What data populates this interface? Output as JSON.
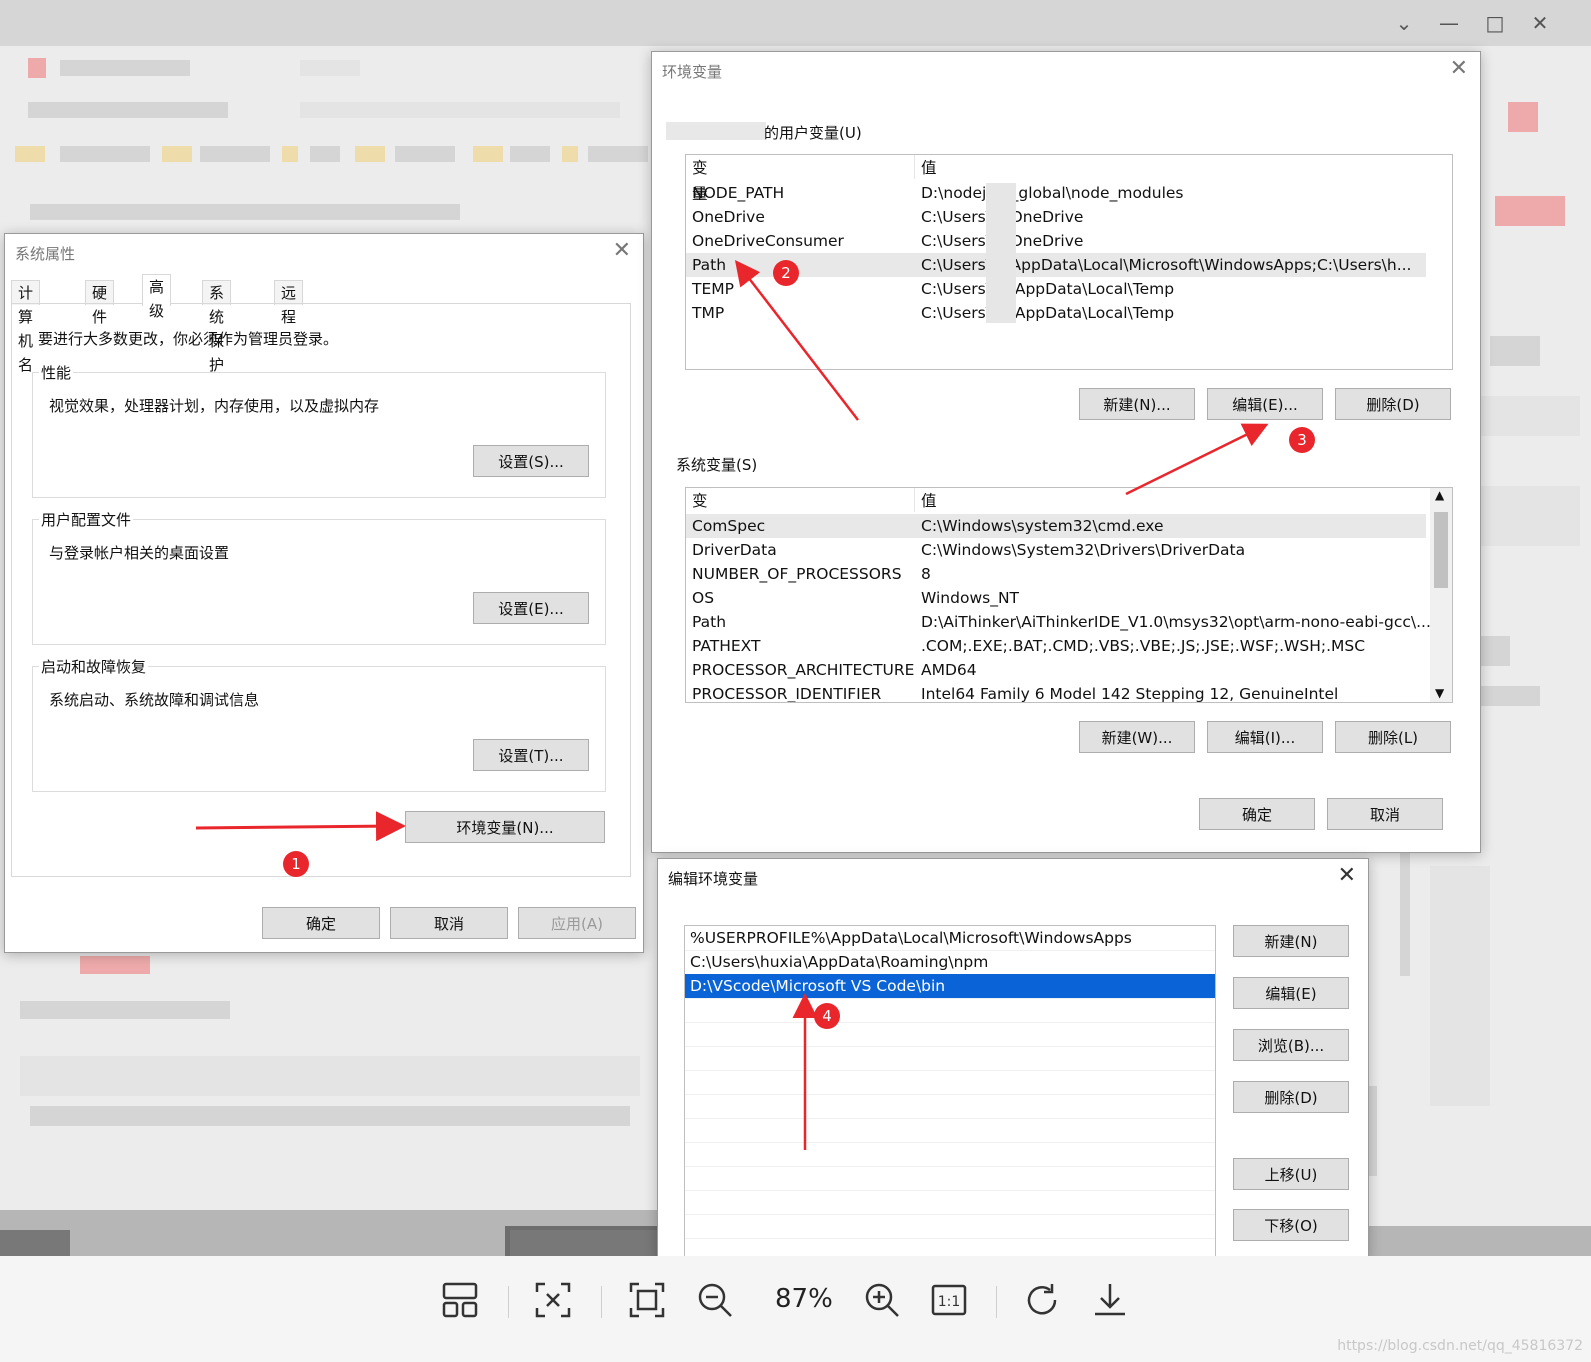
{
  "viewer": {
    "zoom": "87%",
    "watermark": "https://blog.csdn.net/qq_45816372",
    "tools": [
      "gallery-icon",
      "fit-screen-icon",
      "full-size-icon",
      "zoom-out-icon",
      "zoom-in-icon",
      "actual-size-icon",
      "rotate-icon",
      "download-icon"
    ]
  },
  "system_properties": {
    "title": "系统属性",
    "tabs": [
      "计算机名",
      "硬件",
      "高级",
      "系统保护",
      "远程"
    ],
    "active_tab": "高级",
    "admin_note": "要进行大多数更改，你必须作为管理员登录。",
    "performance": {
      "label": "性能",
      "desc": "视觉效果，处理器计划，内存使用，以及虚拟内存",
      "button": "设置(S)..."
    },
    "user_profiles": {
      "label": "用户配置文件",
      "desc": "与登录帐户相关的桌面设置",
      "button": "设置(E)..."
    },
    "startup_recovery": {
      "label": "启动和故障恢复",
      "desc": "系统启动、系统故障和调试信息",
      "button": "设置(T)..."
    },
    "env_button": "环境变量(N)...",
    "ok": "确定",
    "cancel": "取消",
    "apply": "应用(A)"
  },
  "env_vars": {
    "title": "环境变量",
    "user_section": "的用户变量(U)",
    "col_var": "变量",
    "col_val": "值",
    "user_rows": [
      {
        "name": "NODE_PATH",
        "value": "D:\\nodej      de_global\\node_modules"
      },
      {
        "name": "OneDrive",
        "value": "C:\\Users\\      a\\OneDrive"
      },
      {
        "name": "OneDriveConsumer",
        "value": "C:\\Users\\      a\\OneDrive"
      },
      {
        "name": "Path",
        "value": "C:\\Users\\      a\\AppData\\Local\\Microsoft\\WindowsApps;C:\\Users\\h..."
      },
      {
        "name": "TEMP",
        "value": "C:\\Users\\      ia\\AppData\\Local\\Temp"
      },
      {
        "name": "TMP",
        "value": "C:\\Users\\      ia\\AppData\\Local\\Temp"
      }
    ],
    "user_buttons": {
      "new": "新建(N)...",
      "edit": "编辑(E)...",
      "delete": "删除(D)"
    },
    "system_section": "系统变量(S)",
    "system_rows": [
      {
        "name": "ComSpec",
        "value": "C:\\Windows\\system32\\cmd.exe"
      },
      {
        "name": "DriverData",
        "value": "C:\\Windows\\System32\\Drivers\\DriverData"
      },
      {
        "name": "NUMBER_OF_PROCESSORS",
        "value": "8"
      },
      {
        "name": "OS",
        "value": "Windows_NT"
      },
      {
        "name": "Path",
        "value": "D:\\AiThinker\\AiThinkerIDE_V1.0\\msys32\\opt\\arm-nono-eabi-gcc\\..."
      },
      {
        "name": "PATHEXT",
        "value": ".COM;.EXE;.BAT;.CMD;.VBS;.VBE;.JS;.JSE;.WSF;.WSH;.MSC"
      },
      {
        "name": "PROCESSOR_ARCHITECTURE",
        "value": "AMD64"
      },
      {
        "name": "PROCESSOR_IDENTIFIER",
        "value": "Intel64 Family 6 Model 142 Stepping 12, GenuineIntel"
      }
    ],
    "system_buttons": {
      "new": "新建(W)...",
      "edit": "编辑(I)...",
      "delete": "删除(L)"
    },
    "ok": "确定",
    "cancel": "取消"
  },
  "edit_env": {
    "title": "编辑环境变量",
    "entries": [
      "%USERPROFILE%\\AppData\\Local\\Microsoft\\WindowsApps",
      "C:\\Users\\huxia\\AppData\\Roaming\\npm",
      "D:\\VScode\\Microsoft VS Code\\bin"
    ],
    "selected_index": 2,
    "buttons": {
      "new": "新建(N)",
      "edit": "编辑(E)",
      "browse": "浏览(B)...",
      "delete": "删除(D)",
      "up": "上移(U)",
      "down": "下移(O)"
    }
  },
  "annotations": {
    "step1": "1",
    "step2": "2",
    "step3": "3",
    "step4": "4",
    "color": "#e8262b"
  }
}
